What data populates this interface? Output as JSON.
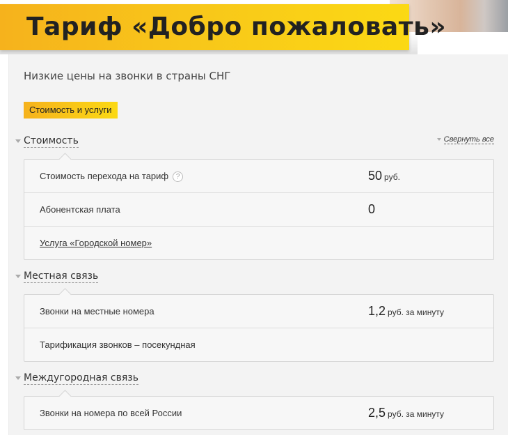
{
  "header": {
    "title": "Тариф «Добро пожаловать»"
  },
  "subtitle": "Низкие цены на звонки в страны СНГ",
  "tab": {
    "label": "Стоимость и услуги"
  },
  "collapse_all": "Свернуть все",
  "sections": [
    {
      "title": "Стоимость",
      "rows": [
        {
          "name": "Стоимость перехода на тариф",
          "value": "50",
          "unit": "руб.",
          "help": "?"
        },
        {
          "name": "Абонентская плата",
          "value": "0",
          "unit": ""
        },
        {
          "name": "Услуга «Городской номер»",
          "value": "",
          "unit": ""
        }
      ]
    },
    {
      "title": "Местная связь",
      "rows": [
        {
          "name": "Звонки на местные номера",
          "value": "1,2",
          "unit": "руб. за минуту"
        },
        {
          "name": "Тарификация звонков – посекундная",
          "value": "",
          "unit": ""
        }
      ]
    },
    {
      "title": "Междугородная связь",
      "rows": [
        {
          "name": "Звонки на номера по всей России",
          "value": "2,5",
          "unit": "руб. за минуту"
        }
      ]
    }
  ],
  "colors": {
    "accent_start": "#f6b21c",
    "accent_end": "#fbd914"
  }
}
